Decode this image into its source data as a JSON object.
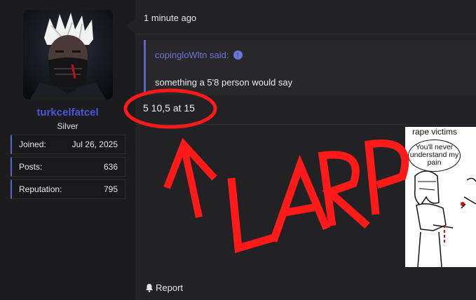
{
  "user": {
    "username": "turkcelfatcel",
    "rank": "Silver",
    "stats": [
      {
        "label": "Joined:",
        "value": "Jul 26, 2025"
      },
      {
        "label": "Posts:",
        "value": "636"
      },
      {
        "label": "Reputation:",
        "value": "795"
      }
    ]
  },
  "post": {
    "timestamp": "1 minute ago",
    "quote": {
      "author": "copingloWltn said:",
      "text": "something a 5'8 person would say"
    },
    "reply": "5 10,5 at 15",
    "report_label": "Report"
  },
  "meme": {
    "title": "rape victims",
    "bubble": "You'll never understand my pain",
    "drawn_text": "LARP"
  },
  "colors": {
    "accent": "#5c65c2",
    "username": "#4a56d6",
    "annotation_red": "#ff1a1a"
  },
  "icons": [
    "arrow-up-circle-icon",
    "bell-icon"
  ]
}
